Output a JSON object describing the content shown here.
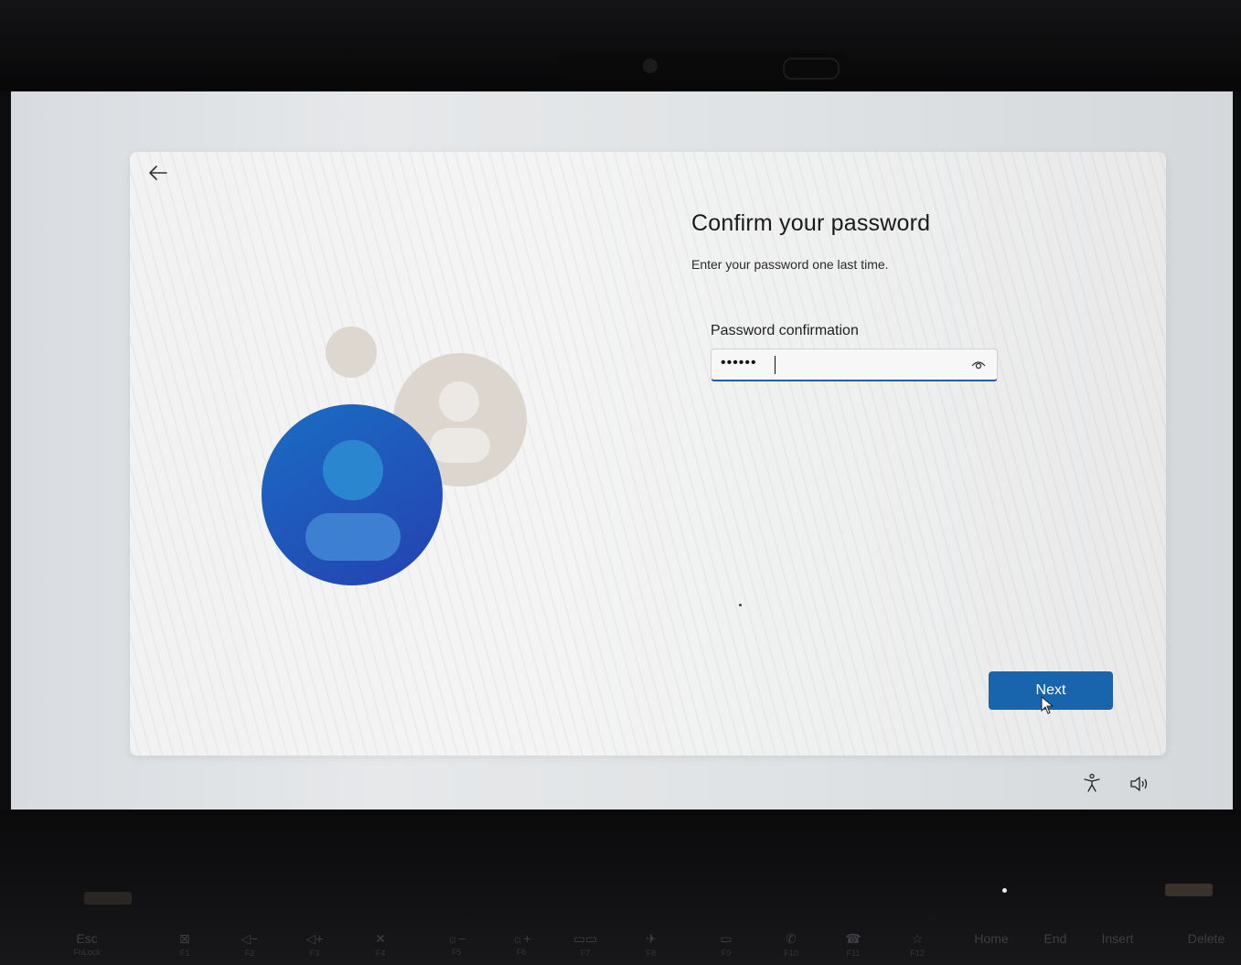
{
  "dialog": {
    "title": "Confirm your password",
    "subtitle": "Enter your password one last time.",
    "field_label": "Password confirmation",
    "password_value": "••••••",
    "next_label": "Next"
  },
  "icons": {
    "back": "arrow-left-icon",
    "reveal": "eye-icon",
    "accessibility": "accessibility-icon",
    "volume": "volume-icon",
    "pointer": "mouse-pointer-icon"
  },
  "colors": {
    "accent": "#1865ad",
    "avatar_front": "#1f63b8",
    "avatar_back": "#dcd6cf"
  },
  "keyboard": {
    "keys": [
      {
        "main": "Esc",
        "sub": "FnLock"
      },
      {
        "main": "⊠",
        "sub": "F1"
      },
      {
        "main": "◁−",
        "sub": "F2"
      },
      {
        "main": "◁+",
        "sub": "F3"
      },
      {
        "main": "✕",
        "sub": "F4"
      },
      {
        "main": "☼−",
        "sub": "F5"
      },
      {
        "main": "☼+",
        "sub": "F6"
      },
      {
        "main": "▭▭",
        "sub": "F7"
      },
      {
        "main": "✈",
        "sub": "F8"
      },
      {
        "main": "▭",
        "sub": "F9"
      },
      {
        "main": "✆",
        "sub": "F10"
      },
      {
        "main": "☎",
        "sub": "F11"
      },
      {
        "main": "☆",
        "sub": "F12"
      },
      {
        "main": "Home",
        "sub": ""
      },
      {
        "main": "End",
        "sub": ""
      },
      {
        "main": "Insert",
        "sub": ""
      },
      {
        "main": "Delete",
        "sub": ""
      }
    ]
  }
}
